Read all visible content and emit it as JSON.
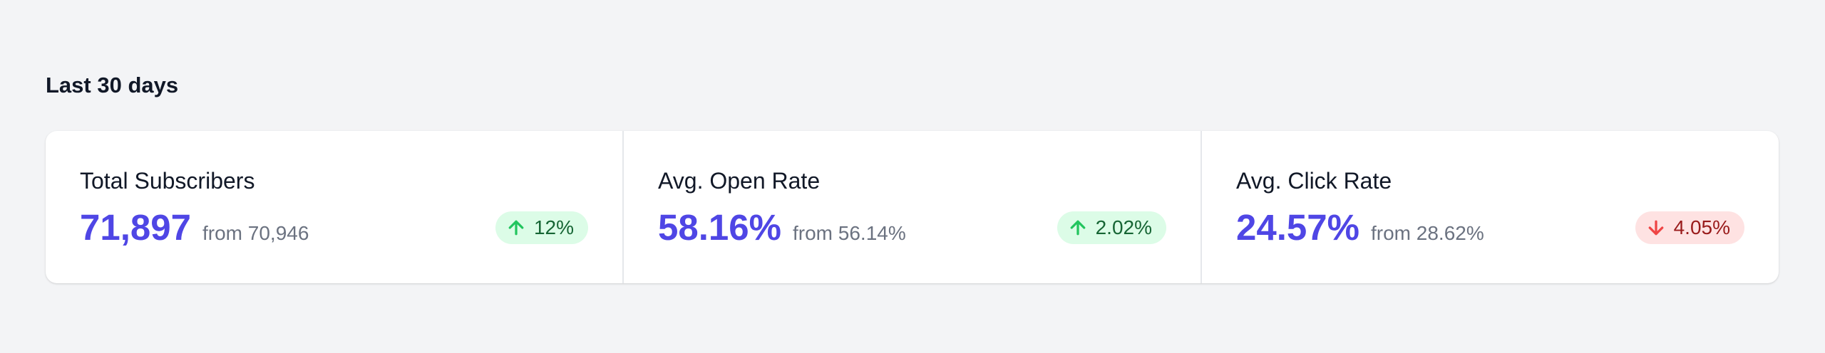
{
  "section": {
    "title": "Last 30 days"
  },
  "stats": [
    {
      "label": "Total Subscribers",
      "value": "71,897",
      "from": "from 70,946",
      "change": "12%",
      "trend": "up",
      "icon": "arrow-up-icon"
    },
    {
      "label": "Avg. Open Rate",
      "value": "58.16%",
      "from": "from 56.14%",
      "change": "2.02%",
      "trend": "up",
      "icon": "arrow-up-icon"
    },
    {
      "label": "Avg. Click Rate",
      "value": "24.57%",
      "from": "from 28.62%",
      "change": "4.05%",
      "trend": "down",
      "icon": "arrow-down-icon"
    }
  ],
  "colors": {
    "accent": "#4f46e5",
    "increase_bg": "#dcfce7",
    "increase_text": "#166534",
    "decrease_bg": "#fee2e2",
    "decrease_text": "#991b1b"
  }
}
